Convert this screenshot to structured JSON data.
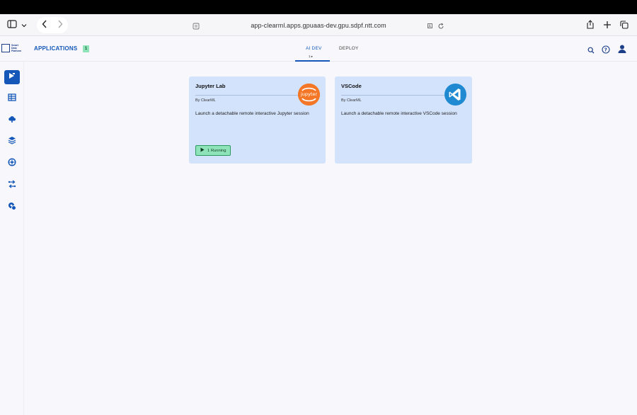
{
  "browser": {
    "url": "app-clearml.apps.gpuaas-dev.gpu.sdpf.ntt.com"
  },
  "header": {
    "title": "APPLICATIONS",
    "count": "1",
    "tabs": [
      {
        "label": "AI DEV",
        "sub": "1 ▸",
        "active": true
      },
      {
        "label": "DEPLOY",
        "active": false
      }
    ],
    "logo_text": "Smart Data Platform"
  },
  "sidebar": {
    "items": [
      {
        "icon": "applications-icon",
        "active": true
      },
      {
        "icon": "dashboard-icon"
      },
      {
        "icon": "cloud-icon"
      },
      {
        "icon": "layers-icon"
      },
      {
        "icon": "network-icon"
      },
      {
        "icon": "pipeline-icon"
      },
      {
        "icon": "models-icon"
      }
    ]
  },
  "cards": [
    {
      "title": "Jupyter Lab",
      "by": "By ClearML",
      "description": "Launch a detachable remote interactive Jupyter session",
      "running_label": "1 Running",
      "logo_label": "jupyter",
      "accent": "#f37726"
    },
    {
      "title": "VSCode",
      "by": "By ClearML",
      "description": "Launch a detachable remote interactive VSCode session",
      "accent": "#1f8ad2"
    }
  ],
  "colors": {
    "brand": "#1457b8",
    "card_bg": "#d3e3fc",
    "running_bg": "#8fe3b8"
  }
}
